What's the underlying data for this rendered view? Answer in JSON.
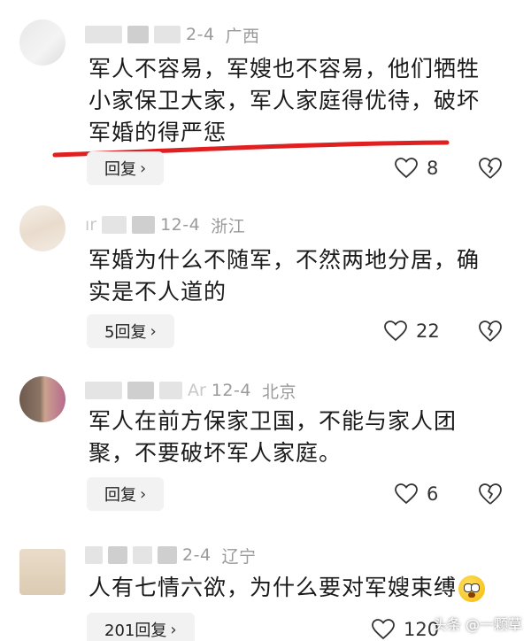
{
  "comments": [
    {
      "date": "12-4",
      "date_visible": "2-4",
      "region": "广西",
      "text": "军人不容易，军嫂也不容易，他们牺牲小家保卫大家，军人家庭得优待，破坏军婚的得严惩",
      "lines": [
        "军人不容易，军嫂也不容易，他们牺牲",
        "小家保卫大家，军人家庭得优待，破坏",
        "军婚的得严惩"
      ],
      "reply_label": "回复",
      "likes": "8"
    },
    {
      "date": "12-4",
      "region": "浙江",
      "prefix": "ır",
      "lines": [
        "军婚为什么不随军，不然两地分居，确",
        "实是不人道的"
      ],
      "reply_label": "5回复",
      "likes": "22"
    },
    {
      "date": "12-4",
      "region": "北京",
      "prefix": "Ar",
      "lines": [
        "军人在前方保家卫国，不能与家人团",
        "聚，不要破坏军人家庭。"
      ],
      "reply_label": "回复",
      "likes": "6"
    },
    {
      "date_visible": "2-4",
      "region": "辽宁",
      "lines": [
        "人有七情六欲，为什么要对军嫂束缚"
      ],
      "reply_label": "201回复",
      "likes": "120"
    }
  ],
  "watermark": "头条 @一颗草",
  "colors": {
    "underline": "#e02020",
    "meta": "#9a9a9a"
  },
  "icons": {
    "like": "heart-outline-icon",
    "dislike": "broken-heart-icon",
    "reply_chevron": "chevron-right-icon"
  }
}
